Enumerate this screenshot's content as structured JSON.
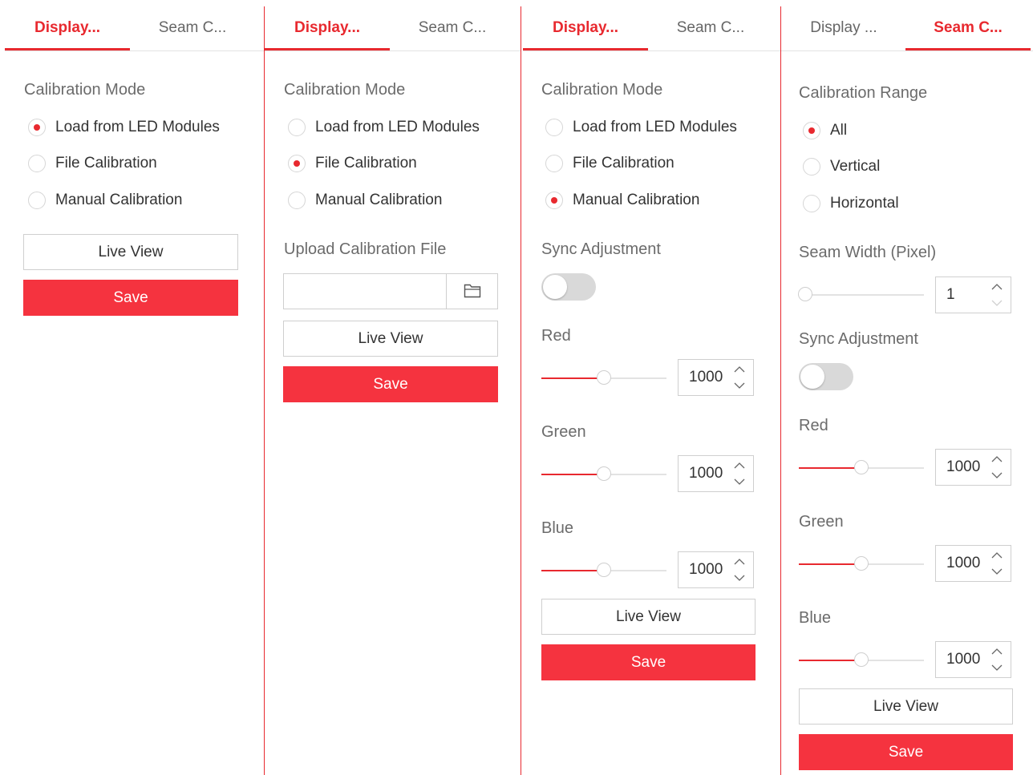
{
  "colors": {
    "accent": "#e8292f",
    "primary_button": "#f5333f",
    "divider": "#e3e3e3"
  },
  "panels": [
    {
      "tabs": [
        {
          "label": "Display...",
          "active": true
        },
        {
          "label": "Seam C...",
          "active": false
        }
      ],
      "calibration_mode_label": "Calibration Mode",
      "options": [
        "Load from LED Modules",
        "File Calibration",
        "Manual Calibration"
      ],
      "selected": 0,
      "live_view": "Live View",
      "save": "Save"
    },
    {
      "tabs": [
        {
          "label": "Display...",
          "active": true
        },
        {
          "label": "Seam C...",
          "active": false
        }
      ],
      "calibration_mode_label": "Calibration Mode",
      "options": [
        "Load from LED Modules",
        "File Calibration",
        "Manual Calibration"
      ],
      "selected": 1,
      "upload_label": "Upload Calibration File",
      "upload_value": "",
      "live_view": "Live View",
      "save": "Save"
    },
    {
      "tabs": [
        {
          "label": "Display...",
          "active": true
        },
        {
          "label": "Seam C...",
          "active": false
        }
      ],
      "calibration_mode_label": "Calibration Mode",
      "options": [
        "Load from LED Modules",
        "File Calibration",
        "Manual Calibration"
      ],
      "selected": 2,
      "sync_label": "Sync Adjustment",
      "sync_on": false,
      "colors": [
        {
          "label": "Red",
          "value": "1000",
          "level": 0.5
        },
        {
          "label": "Green",
          "value": "1000",
          "level": 0.5
        },
        {
          "label": "Blue",
          "value": "1000",
          "level": 0.5
        }
      ],
      "live_view": "Live View",
      "save": "Save"
    },
    {
      "tabs": [
        {
          "label": "Display ...",
          "active": false
        },
        {
          "label": "Seam C...",
          "active": true
        }
      ],
      "range_label": "Calibration Range",
      "range_options": [
        "All",
        "Vertical",
        "Horizontal"
      ],
      "range_selected": 0,
      "seam_width_label": "Seam Width (Pixel)",
      "seam_width_value": "1",
      "seam_width_level": 0.0,
      "sync_label": "Sync Adjustment",
      "sync_on": false,
      "colors": [
        {
          "label": "Red",
          "value": "1000",
          "level": 0.5
        },
        {
          "label": "Green",
          "value": "1000",
          "level": 0.5
        },
        {
          "label": "Blue",
          "value": "1000",
          "level": 0.5
        }
      ],
      "live_view": "Live View",
      "save": "Save"
    }
  ]
}
